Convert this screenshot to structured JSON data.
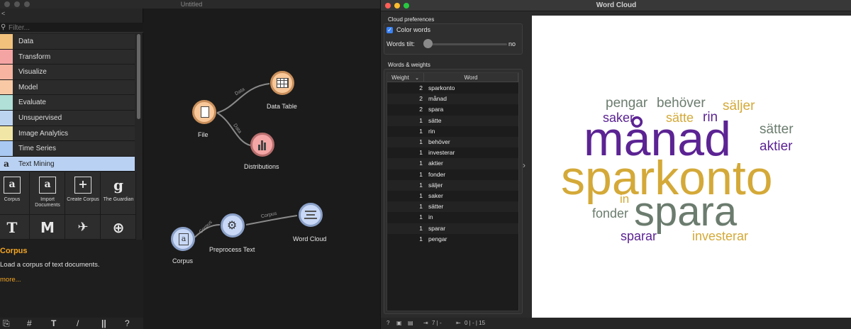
{
  "orange": {
    "window_title": "Untitled",
    "filter_placeholder": "Filter...",
    "categories": [
      {
        "label": "Data",
        "color": "#f2c27d"
      },
      {
        "label": "Transform",
        "color": "#f5a4a4"
      },
      {
        "label": "Visualize",
        "color": "#f7b4a0"
      },
      {
        "label": "Model",
        "color": "#f9c9a6"
      },
      {
        "label": "Evaluate",
        "color": "#b0e0d8"
      },
      {
        "label": "Unsupervised",
        "color": "#bcd4f0"
      },
      {
        "label": "Image Analytics",
        "color": "#f2e6a6"
      },
      {
        "label": "Time Series",
        "color": "#a9c9f2"
      },
      {
        "label": "Text Mining",
        "color": "#b9d1f2"
      }
    ],
    "widgets": [
      {
        "label": "Corpus",
        "icon": "a"
      },
      {
        "label": "Import Documents",
        "icon": "a"
      },
      {
        "label": "Create Corpus",
        "icon": "+"
      },
      {
        "label": "The Guardian",
        "icon": "g"
      },
      {
        "label": "",
        "icon": "T"
      },
      {
        "label": "",
        "icon": "M"
      },
      {
        "label": "",
        "icon": "✈"
      },
      {
        "label": "",
        "icon": "⊕"
      }
    ],
    "description": {
      "title": "Corpus",
      "text": "Load a corpus of text documents.",
      "more": "more..."
    },
    "toolbar_icons": [
      "⎘",
      "#",
      "T",
      "/",
      "||",
      "?"
    ],
    "canvas": {
      "nodes": {
        "file": "File",
        "data_table": "Data Table",
        "distributions": "Distributions",
        "corpus": "Corpus",
        "preprocess": "Preprocess Text",
        "word_cloud": "Word Cloud"
      },
      "links": {
        "file_table": "Data",
        "file_dist": "Data",
        "corpus_pre": "Corpus",
        "pre_wc": "Corpus"
      }
    }
  },
  "wordcloud": {
    "window_title": "Word Cloud",
    "prefs_title": "Cloud preferences",
    "color_words_label": "Color words",
    "color_words_checked": true,
    "tilt_label": "Words tilt:",
    "tilt_value": "no",
    "table_title": "Words & weights",
    "col_weight": "Weight",
    "col_word": "Word",
    "rows": [
      {
        "weight": "2",
        "word": "sparkonto"
      },
      {
        "weight": "2",
        "word": "månad"
      },
      {
        "weight": "2",
        "word": "spara"
      },
      {
        "weight": "1",
        "word": "sätte"
      },
      {
        "weight": "1",
        "word": "rin"
      },
      {
        "weight": "1",
        "word": "behöver"
      },
      {
        "weight": "1",
        "word": "investerar"
      },
      {
        "weight": "1",
        "word": "aktier"
      },
      {
        "weight": "1",
        "word": "fonder"
      },
      {
        "weight": "1",
        "word": "säljer"
      },
      {
        "weight": "1",
        "word": "saker"
      },
      {
        "weight": "1",
        "word": "sätter"
      },
      {
        "weight": "1",
        "word": "in"
      },
      {
        "weight": "1",
        "word": "sparar"
      },
      {
        "weight": "1",
        "word": "pengar"
      }
    ],
    "cloud_words": [
      {
        "text": "pengar",
        "color": "#6b7c6e"
      },
      {
        "text": "behöver",
        "color": "#6b7c6e"
      },
      {
        "text": "säljer",
        "color": "#d4a938"
      },
      {
        "text": "saker",
        "color": "#5b2393"
      },
      {
        "text": "sätte",
        "color": "#d4a938"
      },
      {
        "text": "rin",
        "color": "#5b2393"
      },
      {
        "text": "månad",
        "color": "#5b2393"
      },
      {
        "text": "sätter",
        "color": "#6b7c6e"
      },
      {
        "text": "aktier",
        "color": "#5b2393"
      },
      {
        "text": "sparkonto",
        "color": "#d4a938"
      },
      {
        "text": "in",
        "color": "#d4a938"
      },
      {
        "text": "fonder",
        "color": "#6b7c6e"
      },
      {
        "text": "spara",
        "color": "#6b7c6e"
      },
      {
        "text": "sparar",
        "color": "#5b2393"
      },
      {
        "text": "investerar",
        "color": "#d4a938"
      }
    ],
    "status": {
      "in_label": "7 | -",
      "out_label": "0 | - | 15"
    }
  }
}
